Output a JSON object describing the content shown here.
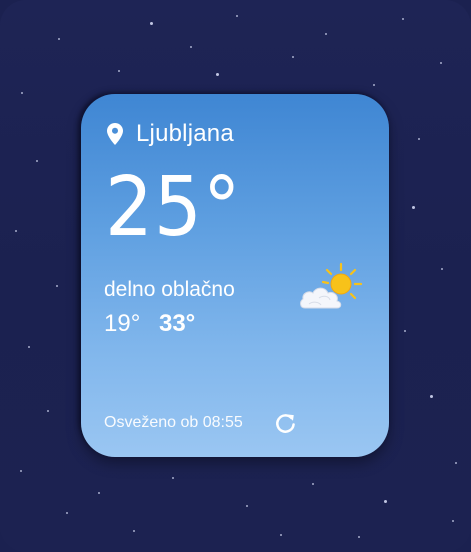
{
  "widget": {
    "location": "Ljubljana",
    "temperature": "25°",
    "condition": "delno oblačno",
    "temp_min": "19°",
    "temp_max": "33°",
    "updated": "Osveženo ob 08:55"
  },
  "icons": {
    "location": "location-pin-icon",
    "weather": "partly-cloudy-icon",
    "refresh": "refresh-icon"
  },
  "colors": {
    "background": "#1b2150",
    "widget_top": "#3f86d3",
    "widget_bottom": "#9ac6f2",
    "sun": "#f7c21a"
  }
}
